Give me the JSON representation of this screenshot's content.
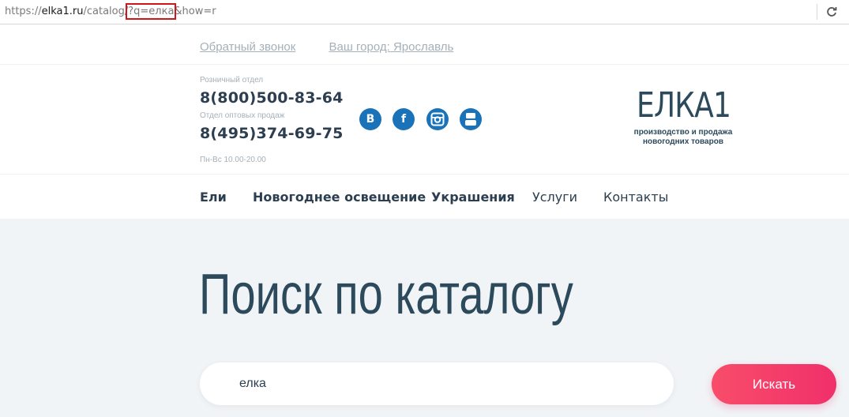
{
  "browser": {
    "url_prefix": "https://",
    "url_host": "elka1.ru",
    "url_path": "/catalog/",
    "url_query_highlight": "?q=елка",
    "url_suffix": "&how=r",
    "reload_icon": "reload-icon"
  },
  "top_links": {
    "callback": "Обратный звонок",
    "city": "Ваш город: Ярославль"
  },
  "contacts": {
    "retail_label": "Розничный отдел",
    "retail_phone": "8(800)500-83-64",
    "wholesale_label": "Отдел оптовых продаж",
    "wholesale_phone": "8(495)374-69-75",
    "hours": "Пн-Вс 10.00-20.00"
  },
  "social": {
    "vk_letter": "B",
    "fb_letter": "f",
    "accent_color": "#1a73b8"
  },
  "logo": {
    "name": "ЕЛКА1",
    "tagline_line1": "производство и продажа",
    "tagline_line2": "новогодних товаров"
  },
  "nav": {
    "items": [
      {
        "label": "Ели"
      },
      {
        "label": "Новогоднее освещение"
      },
      {
        "label": "Украшения"
      },
      {
        "label": "Услуги"
      },
      {
        "label": "Контакты"
      }
    ]
  },
  "hero": {
    "title": "Поиск по каталогу"
  },
  "search": {
    "value": "елка",
    "button_label": "Искать",
    "button_color": "#f0306a"
  }
}
